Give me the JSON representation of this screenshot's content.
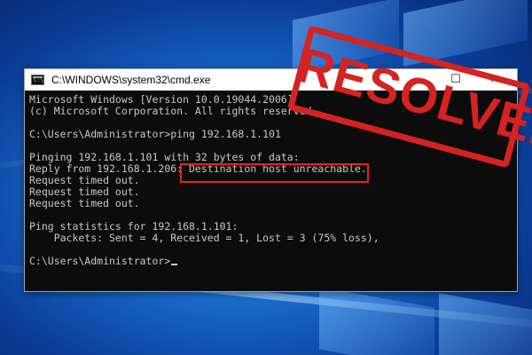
{
  "window": {
    "title": "C:\\WINDOWS\\system32\\cmd.exe",
    "controls": {
      "minimize": "—",
      "maximize": "☐",
      "close": "✕"
    },
    "icon": "cmd-icon"
  },
  "console": {
    "lines": [
      "Microsoft Windows [Version 10.0.19044.2006]",
      "(c) Microsoft Corporation. All rights reserved.",
      "",
      "C:\\Users\\Administrator>ping 192.168.1.101",
      "",
      "Pinging 192.168.1.101 with 32 bytes of data:",
      "Reply from 192.168.1.206: Destination host unreachable.",
      "Request timed out.",
      "Request timed out.",
      "Request timed out.",
      "",
      "Ping statistics for 192.168.1.101:",
      "    Packets: Sent = 4, Received = 1, Lost = 3 (75% loss),",
      "",
      "C:\\Users\\Administrator>"
    ],
    "highlighted_text": "Destination host unreachable."
  },
  "stamp": {
    "text": "RESOLVED",
    "color": "#d42320"
  },
  "colors": {
    "console_bg": "#0c0c0c",
    "console_fg": "#c8c8c8",
    "highlight": "#e8211c",
    "desktop": "#1a6fd0"
  }
}
